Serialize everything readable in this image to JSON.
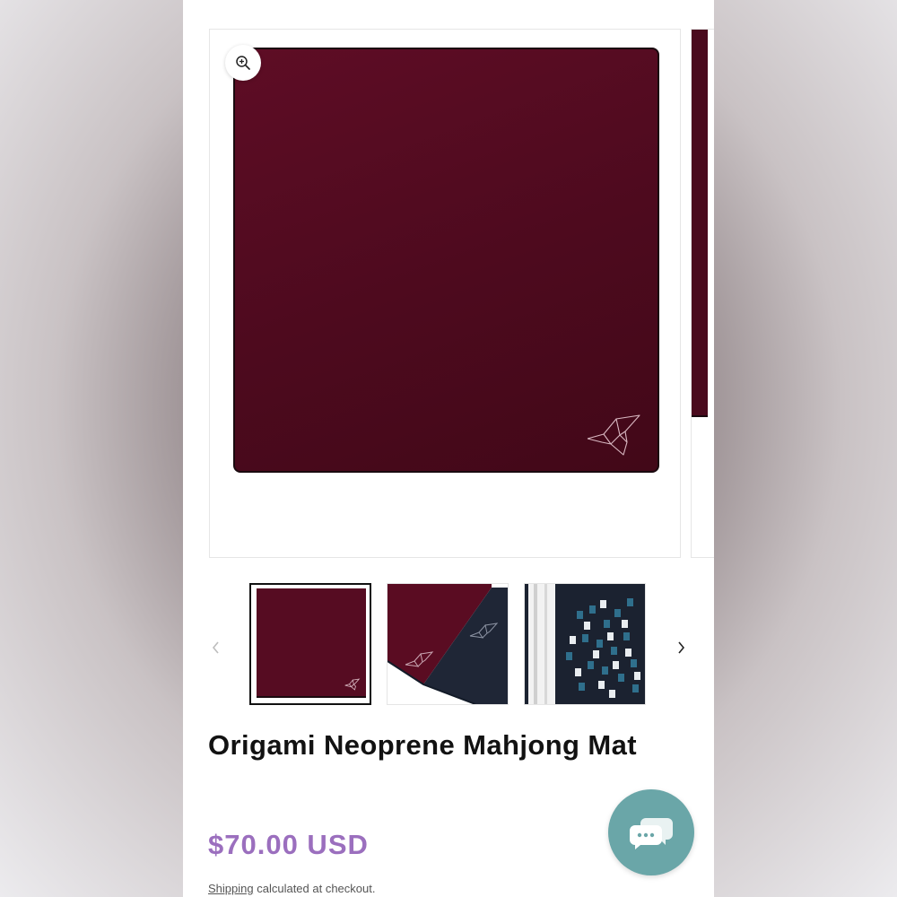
{
  "product": {
    "title": "Origami Neoprene Mahjong Mat",
    "price": "$70.00 USD",
    "shipping_link": "Shipping",
    "shipping_text": " calculated at checkout."
  },
  "gallery": {
    "main_color": "#560c22",
    "zoom_icon": "zoom-in-icon",
    "prev_icon": "chevron-left-icon",
    "next_icon": "chevron-right-icon"
  },
  "colors": {
    "price": "#9b6fbe",
    "chat": "#6aa6a8"
  }
}
